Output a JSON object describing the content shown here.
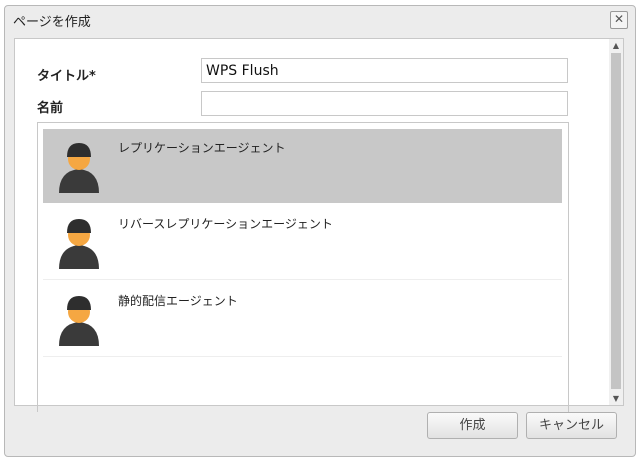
{
  "dialog": {
    "title": "ページを作成"
  },
  "form": {
    "title_label": "タイトル*",
    "title_value": "WPS Flush",
    "name_label": "名前",
    "name_value": ""
  },
  "templates": [
    {
      "label": "レプリケーションエージェント",
      "selected": true
    },
    {
      "label": "リバースレプリケーションエージェント",
      "selected": false
    },
    {
      "label": "静的配信エージェント",
      "selected": false
    }
  ],
  "footer": {
    "create": "作成",
    "cancel": "キャンセル"
  }
}
